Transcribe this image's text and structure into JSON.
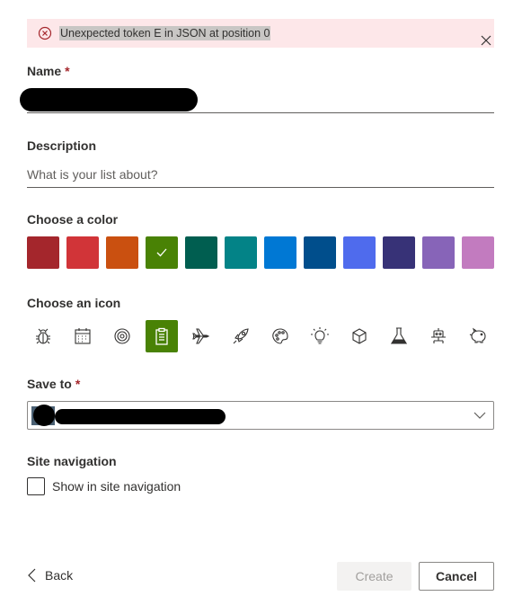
{
  "error": {
    "message": "Unexpected token E in JSON at position 0"
  },
  "name_field": {
    "label": "Name",
    "required_mark": "*"
  },
  "description_field": {
    "label": "Description",
    "placeholder": "What is your list about?"
  },
  "color_picker": {
    "label": "Choose a color",
    "selected_index": 3,
    "colors": [
      "#a4262c",
      "#d13438",
      "#ca5010",
      "#498205",
      "#005e50",
      "#038387",
      "#0078d4",
      "#004e8c",
      "#4f6bed",
      "#373277",
      "#8764b8",
      "#c27bbf"
    ]
  },
  "icon_picker": {
    "label": "Choose an icon",
    "selected_index": 3,
    "selected_color": "#498205",
    "icons": [
      "bug-icon",
      "calendar-icon",
      "target-icon",
      "clipboard-icon",
      "airplane-icon",
      "rocket-icon",
      "palette-icon",
      "lightbulb-icon",
      "cube-icon",
      "flask-icon",
      "robot-icon",
      "piggy-bank-icon"
    ]
  },
  "save_to": {
    "label": "Save to",
    "required_mark": "*"
  },
  "site_navigation": {
    "label": "Site navigation",
    "checkbox_label": "Show in site navigation",
    "checked": false
  },
  "footer": {
    "back_label": "Back",
    "create_label": "Create",
    "cancel_label": "Cancel"
  }
}
